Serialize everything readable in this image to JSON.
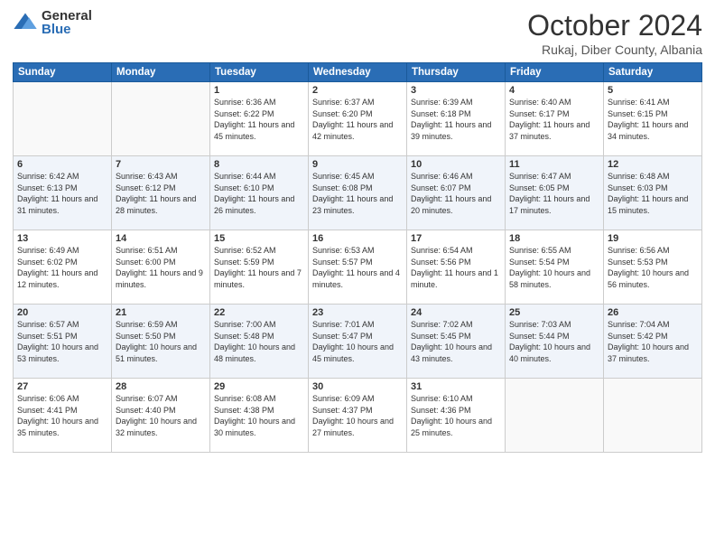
{
  "logo": {
    "general": "General",
    "blue": "Blue"
  },
  "title": "October 2024",
  "location": "Rukaj, Diber County, Albania",
  "days_of_week": [
    "Sunday",
    "Monday",
    "Tuesday",
    "Wednesday",
    "Thursday",
    "Friday",
    "Saturday"
  ],
  "weeks": [
    [
      {
        "num": "",
        "empty": true
      },
      {
        "num": "",
        "empty": true
      },
      {
        "num": "1",
        "sunrise": "Sunrise: 6:36 AM",
        "sunset": "Sunset: 6:22 PM",
        "daylight": "Daylight: 11 hours and 45 minutes."
      },
      {
        "num": "2",
        "sunrise": "Sunrise: 6:37 AM",
        "sunset": "Sunset: 6:20 PM",
        "daylight": "Daylight: 11 hours and 42 minutes."
      },
      {
        "num": "3",
        "sunrise": "Sunrise: 6:39 AM",
        "sunset": "Sunset: 6:18 PM",
        "daylight": "Daylight: 11 hours and 39 minutes."
      },
      {
        "num": "4",
        "sunrise": "Sunrise: 6:40 AM",
        "sunset": "Sunset: 6:17 PM",
        "daylight": "Daylight: 11 hours and 37 minutes."
      },
      {
        "num": "5",
        "sunrise": "Sunrise: 6:41 AM",
        "sunset": "Sunset: 6:15 PM",
        "daylight": "Daylight: 11 hours and 34 minutes."
      }
    ],
    [
      {
        "num": "6",
        "sunrise": "Sunrise: 6:42 AM",
        "sunset": "Sunset: 6:13 PM",
        "daylight": "Daylight: 11 hours and 31 minutes."
      },
      {
        "num": "7",
        "sunrise": "Sunrise: 6:43 AM",
        "sunset": "Sunset: 6:12 PM",
        "daylight": "Daylight: 11 hours and 28 minutes."
      },
      {
        "num": "8",
        "sunrise": "Sunrise: 6:44 AM",
        "sunset": "Sunset: 6:10 PM",
        "daylight": "Daylight: 11 hours and 26 minutes."
      },
      {
        "num": "9",
        "sunrise": "Sunrise: 6:45 AM",
        "sunset": "Sunset: 6:08 PM",
        "daylight": "Daylight: 11 hours and 23 minutes."
      },
      {
        "num": "10",
        "sunrise": "Sunrise: 6:46 AM",
        "sunset": "Sunset: 6:07 PM",
        "daylight": "Daylight: 11 hours and 20 minutes."
      },
      {
        "num": "11",
        "sunrise": "Sunrise: 6:47 AM",
        "sunset": "Sunset: 6:05 PM",
        "daylight": "Daylight: 11 hours and 17 minutes."
      },
      {
        "num": "12",
        "sunrise": "Sunrise: 6:48 AM",
        "sunset": "Sunset: 6:03 PM",
        "daylight": "Daylight: 11 hours and 15 minutes."
      }
    ],
    [
      {
        "num": "13",
        "sunrise": "Sunrise: 6:49 AM",
        "sunset": "Sunset: 6:02 PM",
        "daylight": "Daylight: 11 hours and 12 minutes."
      },
      {
        "num": "14",
        "sunrise": "Sunrise: 6:51 AM",
        "sunset": "Sunset: 6:00 PM",
        "daylight": "Daylight: 11 hours and 9 minutes."
      },
      {
        "num": "15",
        "sunrise": "Sunrise: 6:52 AM",
        "sunset": "Sunset: 5:59 PM",
        "daylight": "Daylight: 11 hours and 7 minutes."
      },
      {
        "num": "16",
        "sunrise": "Sunrise: 6:53 AM",
        "sunset": "Sunset: 5:57 PM",
        "daylight": "Daylight: 11 hours and 4 minutes."
      },
      {
        "num": "17",
        "sunrise": "Sunrise: 6:54 AM",
        "sunset": "Sunset: 5:56 PM",
        "daylight": "Daylight: 11 hours and 1 minute."
      },
      {
        "num": "18",
        "sunrise": "Sunrise: 6:55 AM",
        "sunset": "Sunset: 5:54 PM",
        "daylight": "Daylight: 10 hours and 58 minutes."
      },
      {
        "num": "19",
        "sunrise": "Sunrise: 6:56 AM",
        "sunset": "Sunset: 5:53 PM",
        "daylight": "Daylight: 10 hours and 56 minutes."
      }
    ],
    [
      {
        "num": "20",
        "sunrise": "Sunrise: 6:57 AM",
        "sunset": "Sunset: 5:51 PM",
        "daylight": "Daylight: 10 hours and 53 minutes."
      },
      {
        "num": "21",
        "sunrise": "Sunrise: 6:59 AM",
        "sunset": "Sunset: 5:50 PM",
        "daylight": "Daylight: 10 hours and 51 minutes."
      },
      {
        "num": "22",
        "sunrise": "Sunrise: 7:00 AM",
        "sunset": "Sunset: 5:48 PM",
        "daylight": "Daylight: 10 hours and 48 minutes."
      },
      {
        "num": "23",
        "sunrise": "Sunrise: 7:01 AM",
        "sunset": "Sunset: 5:47 PM",
        "daylight": "Daylight: 10 hours and 45 minutes."
      },
      {
        "num": "24",
        "sunrise": "Sunrise: 7:02 AM",
        "sunset": "Sunset: 5:45 PM",
        "daylight": "Daylight: 10 hours and 43 minutes."
      },
      {
        "num": "25",
        "sunrise": "Sunrise: 7:03 AM",
        "sunset": "Sunset: 5:44 PM",
        "daylight": "Daylight: 10 hours and 40 minutes."
      },
      {
        "num": "26",
        "sunrise": "Sunrise: 7:04 AM",
        "sunset": "Sunset: 5:42 PM",
        "daylight": "Daylight: 10 hours and 37 minutes."
      }
    ],
    [
      {
        "num": "27",
        "sunrise": "Sunrise: 6:06 AM",
        "sunset": "Sunset: 4:41 PM",
        "daylight": "Daylight: 10 hours and 35 minutes."
      },
      {
        "num": "28",
        "sunrise": "Sunrise: 6:07 AM",
        "sunset": "Sunset: 4:40 PM",
        "daylight": "Daylight: 10 hours and 32 minutes."
      },
      {
        "num": "29",
        "sunrise": "Sunrise: 6:08 AM",
        "sunset": "Sunset: 4:38 PM",
        "daylight": "Daylight: 10 hours and 30 minutes."
      },
      {
        "num": "30",
        "sunrise": "Sunrise: 6:09 AM",
        "sunset": "Sunset: 4:37 PM",
        "daylight": "Daylight: 10 hours and 27 minutes."
      },
      {
        "num": "31",
        "sunrise": "Sunrise: 6:10 AM",
        "sunset": "Sunset: 4:36 PM",
        "daylight": "Daylight: 10 hours and 25 minutes."
      },
      {
        "num": "",
        "empty": true
      },
      {
        "num": "",
        "empty": true
      }
    ]
  ]
}
